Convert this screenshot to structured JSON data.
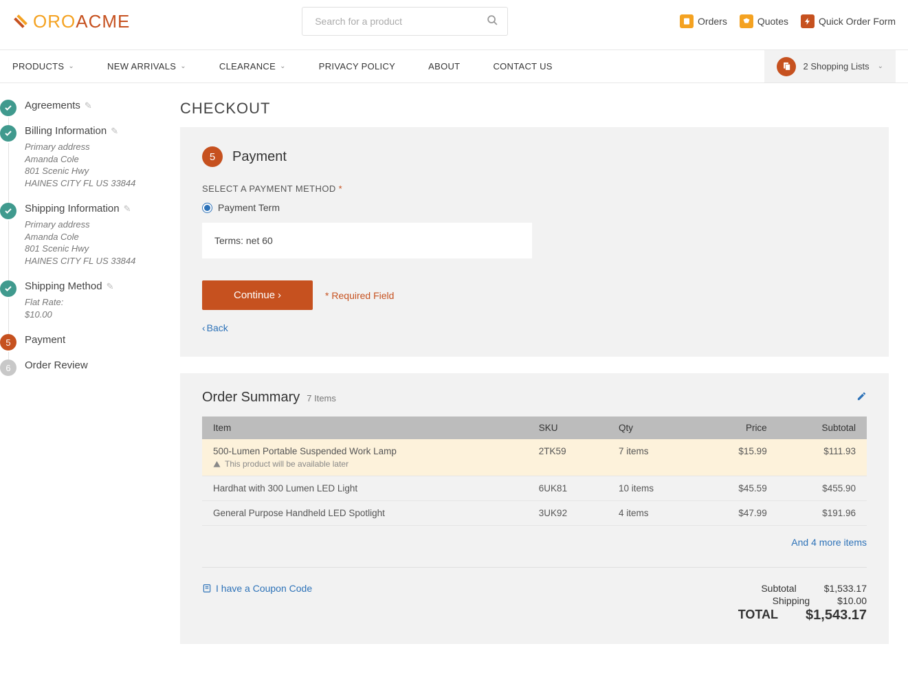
{
  "brand": {
    "part1": "ORO",
    "part2": "ACME"
  },
  "search": {
    "placeholder": "Search for a product"
  },
  "toplinks": {
    "orders": "Orders",
    "quotes": "Quotes",
    "quick": "Quick Order Form"
  },
  "nav": {
    "items": [
      "PRODUCTS",
      "NEW ARRIVALS",
      "CLEARANCE",
      "PRIVACY POLICY",
      "ABOUT",
      "CONTACT US"
    ],
    "cart": "2 Shopping Lists"
  },
  "steps": {
    "agreements": {
      "label": "Agreements"
    },
    "billing": {
      "label": "Billing Information",
      "lines": [
        "Primary address",
        "Amanda Cole",
        "801 Scenic Hwy",
        "HAINES CITY FL US 33844"
      ]
    },
    "shipping": {
      "label": "Shipping Information",
      "lines": [
        "Primary address",
        "Amanda Cole",
        "801 Scenic Hwy",
        "HAINES CITY FL US 33844"
      ]
    },
    "shipmethod": {
      "label": "Shipping Method",
      "lines": [
        "Flat Rate:",
        "$10.00"
      ]
    },
    "payment": {
      "num": "5",
      "label": "Payment"
    },
    "review": {
      "num": "6",
      "label": "Order Review"
    }
  },
  "title": "CHECKOUT",
  "paymentStep": {
    "num": "5",
    "title": "Payment",
    "fieldLabel": "SELECT A PAYMENT METHOD",
    "option": "Payment Term",
    "terms": "Terms: net 60",
    "continue": "Continue",
    "required": "* Required Field",
    "back": "Back"
  },
  "summary": {
    "title": "Order Summary",
    "count": "7 Items",
    "headers": {
      "item": "Item",
      "sku": "SKU",
      "qty": "Qty",
      "price": "Price",
      "subtotal": "Subtotal"
    },
    "rows": [
      {
        "name": "500-Lumen Portable Suspended Work Lamp",
        "warn": "This product will be available later",
        "sku": "2TK59",
        "qty": "7 items",
        "price": "$15.99",
        "subtotal": "$111.93",
        "highlight": true
      },
      {
        "name": "Hardhat with 300 Lumen LED Light",
        "sku": "6UK81",
        "qty": "10 items",
        "price": "$45.59",
        "subtotal": "$455.90"
      },
      {
        "name": "General Purpose Handheld LED Spotlight",
        "sku": "3UK92",
        "qty": "4 items",
        "price": "$47.99",
        "subtotal": "$191.96",
        "faded": true
      }
    ],
    "more": "And 4 more items",
    "coupon": "I have a Coupon Code",
    "totals": {
      "subtotalLabel": "Subtotal",
      "subtotal": "$1,533.17",
      "shippingLabel": "Shipping",
      "shipping": "$10.00",
      "totalLabel": "TOTAL",
      "total": "$1,543.17"
    }
  }
}
